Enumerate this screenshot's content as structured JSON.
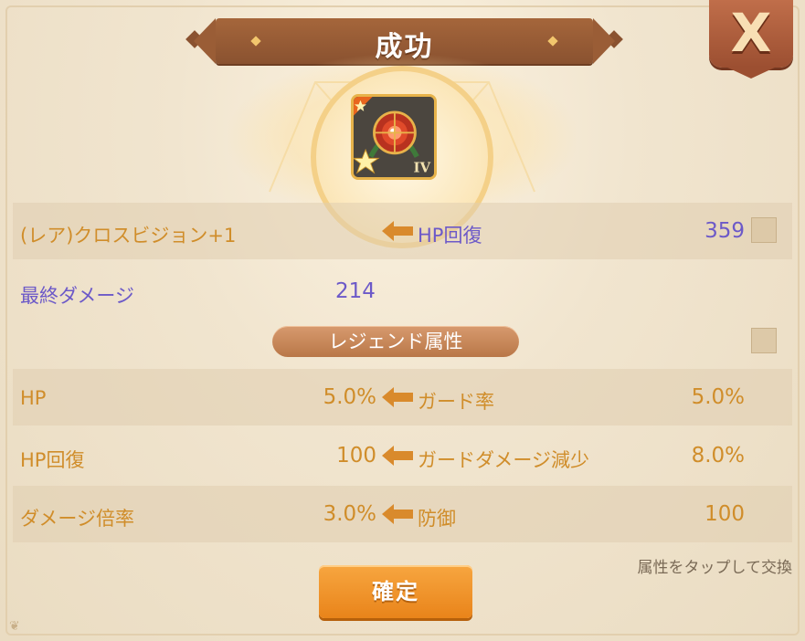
{
  "popup": {
    "title": "成功",
    "close_label": "X"
  },
  "item": {
    "icon": "rare-eye-badge-icon",
    "grade_label": "IV",
    "name": "(レア)クロスビジョン+1"
  },
  "main_stat": {
    "option_label": "HP回復",
    "option_value": "359"
  },
  "final_damage": {
    "label": "最終ダメージ",
    "value": "214"
  },
  "legend": {
    "label": "レジェンド属性",
    "rows": [
      {
        "cur_label": "HP",
        "cur_value": "5.0%",
        "new_label": "ガード率",
        "new_value": "5.0%"
      },
      {
        "cur_label": "HP回復",
        "cur_value": "100",
        "new_label": "ガードダメージ減少",
        "new_value": "8.0%"
      },
      {
        "cur_label": "ダメージ倍率",
        "cur_value": "3.0%",
        "new_label": "防御",
        "new_value": "100"
      }
    ]
  },
  "footer": {
    "hint": "属性をタップして交換",
    "confirm_label": "確定"
  },
  "colors": {
    "accent": "#e9841a",
    "ribbon": "#8a5230",
    "purple_text": "#6c59c8",
    "gold_text": "#d08d2a"
  }
}
